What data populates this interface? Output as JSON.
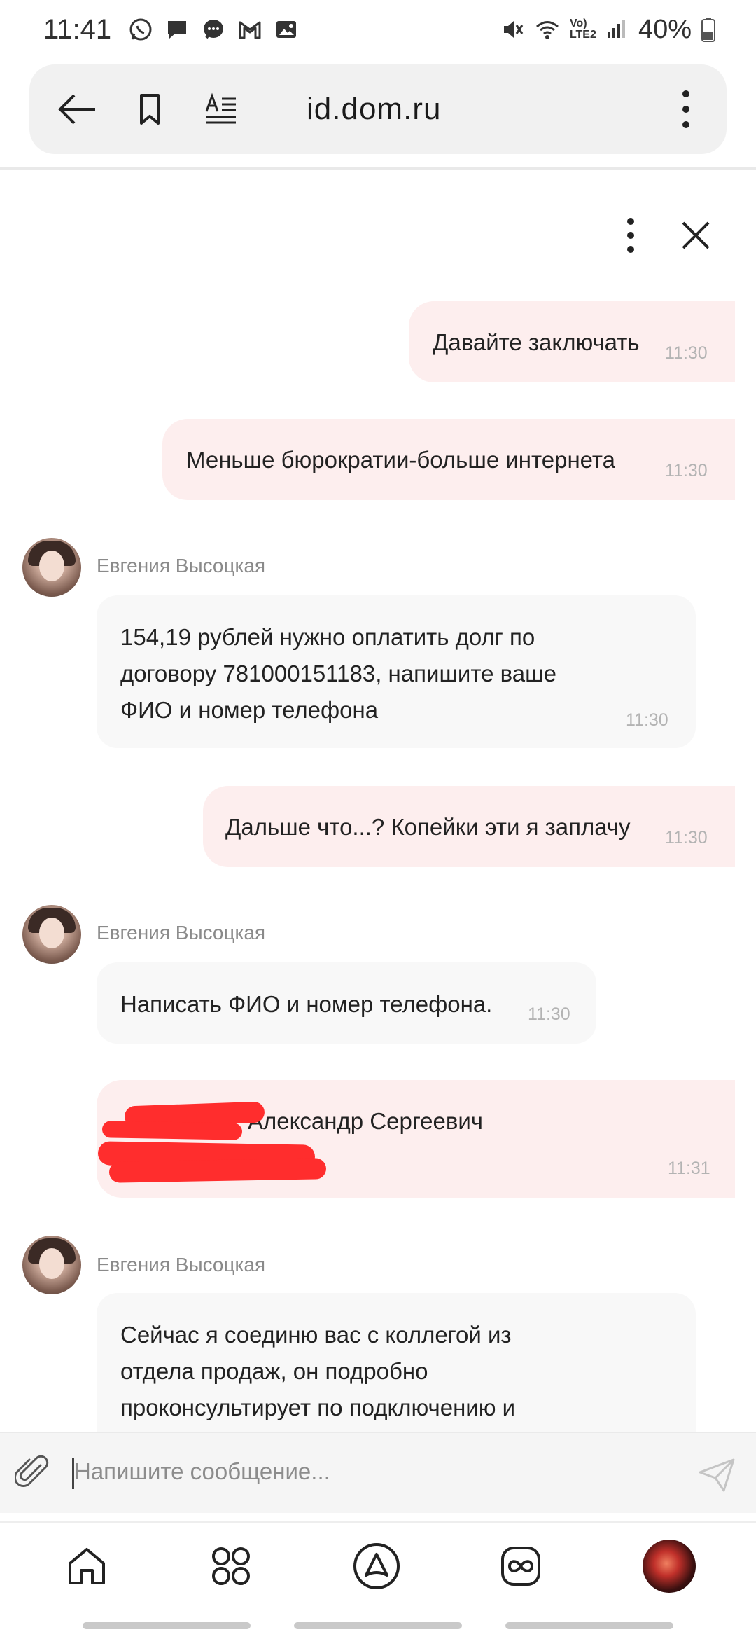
{
  "status_bar": {
    "time": "11:41",
    "battery": "40%",
    "network": "Vo) LTE2",
    "icons_left": [
      "whatsapp-icon",
      "chat-icon",
      "messenger-icon",
      "gmail-icon",
      "gallery-icon"
    ],
    "icons_right": [
      "mute-icon",
      "wifi-icon",
      "signal-icon",
      "battery-icon"
    ]
  },
  "browser": {
    "url": "id.dom.ru",
    "icons": [
      "back-arrow-icon",
      "bookmark-icon",
      "reader-mode-icon",
      "more-vertical-icon"
    ]
  },
  "chat": {
    "header_icons": [
      "more-vertical-icon",
      "close-icon"
    ],
    "messages": [
      {
        "type": "out",
        "text": "Давайте заключать",
        "time": "11:30"
      },
      {
        "type": "out",
        "text": "Меньше бюрократии-больше интернета",
        "time": "11:30"
      },
      {
        "type": "in",
        "sender": "Евгения Высоцкая",
        "lines": [
          "154,19 рублей нужно оплатить долг по",
          "договору 781000151183, напишите ваше",
          "ФИО и номер телефона"
        ],
        "time": "11:30"
      },
      {
        "type": "out",
        "text": "Дальше что...? Копейки эти я заплачу",
        "time": "11:30"
      },
      {
        "type": "in",
        "sender": "Евгения Высоцкая",
        "lines": [
          "Написать ФИО и номер телефона."
        ],
        "time": "11:30"
      },
      {
        "type": "out",
        "text": "Александр Сергеевич",
        "time": "11:31",
        "redacted": true
      },
      {
        "type": "in",
        "sender": "Евгения Высоцкая",
        "lines": [
          "Сейчас я соединю вас с коллегой из",
          "отдела продаж, он подробно",
          "проконсультирует по подключению и"
        ]
      }
    ]
  },
  "composer": {
    "placeholder": "Напишите сообщение...",
    "icons": [
      "paperclip-icon",
      "send-icon"
    ]
  },
  "bottom_nav": {
    "items": [
      "home-icon",
      "apps-grid-icon",
      "assistant-icon",
      "infinity-icon",
      "profile-avatar"
    ]
  },
  "colors": {
    "outgoing_bubble": "#fdeeee",
    "incoming_bubble": "#f8f8f8",
    "redaction": "#ff2d2d",
    "timestamp": "#b3b3b3"
  }
}
